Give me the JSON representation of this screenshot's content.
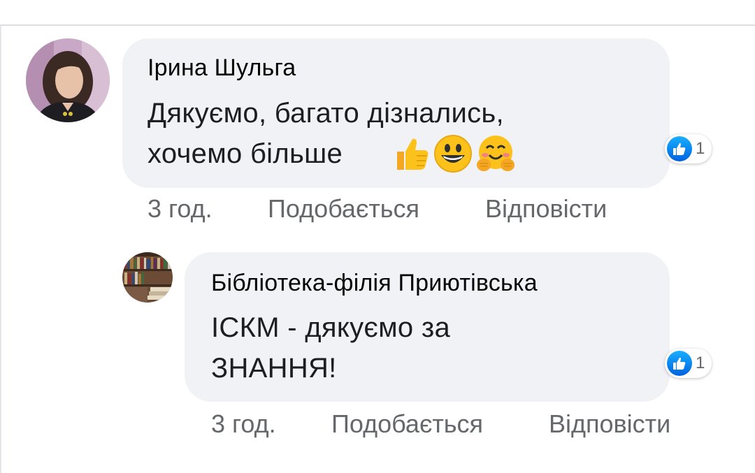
{
  "comments": [
    {
      "author": "Ірина Шульга",
      "text_lines": [
        "Дякуємо, багато дізнались,",
        "хочемо більше"
      ],
      "emojis": [
        "thumbs-up",
        "grinning-face",
        "smiling-face-with-open-hands"
      ],
      "reaction_count": "1",
      "time": "3 год.",
      "like_label": "Подобається",
      "reply_label": "Відповісти"
    },
    {
      "author": "Бібліотека-філія Приютівська",
      "text_lines": [
        "ІСКМ - дякуємо за",
        "ЗНАННЯ!"
      ],
      "reaction_count": "1",
      "time": "3 год.",
      "like_label": "Подобається",
      "reply_label": "Відповісти"
    }
  ],
  "colors": {
    "bubble": "#f0f2f5",
    "meta_text": "#65676b",
    "like_blue": "#1877f2"
  }
}
